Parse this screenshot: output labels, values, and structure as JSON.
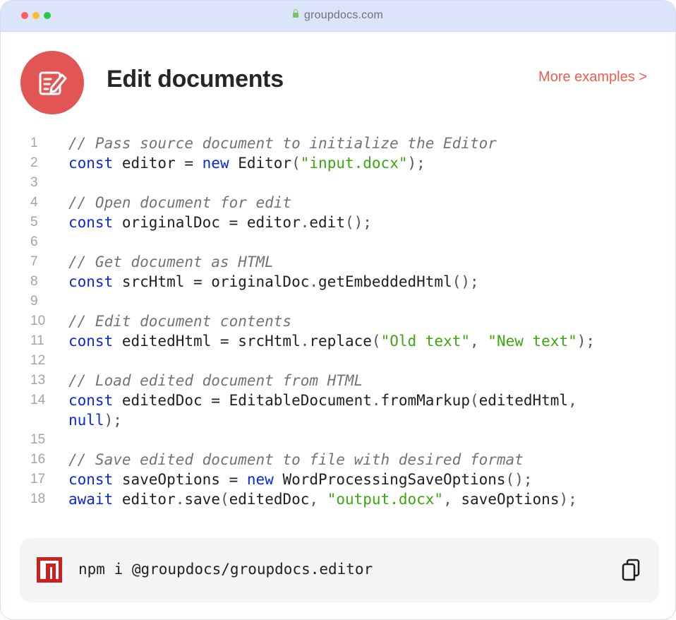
{
  "browser": {
    "url": "groupdocs.com"
  },
  "header": {
    "title": "Edit documents",
    "more_link": "More examples >"
  },
  "code": {
    "lines": [
      [
        {
          "t": "cm",
          "v": "// Pass source document to initialize the Editor"
        }
      ],
      [
        {
          "t": "kw",
          "v": "const"
        },
        {
          "t": "tx",
          "v": " editor = "
        },
        {
          "t": "kw",
          "v": "new"
        },
        {
          "t": "tx",
          "v": " Editor"
        },
        {
          "t": "pn",
          "v": "("
        },
        {
          "t": "st",
          "v": "\"input.docx\""
        },
        {
          "t": "pn",
          "v": ");"
        }
      ],
      [],
      [
        {
          "t": "cm",
          "v": "// Open document for edit"
        }
      ],
      [
        {
          "t": "kw",
          "v": "const"
        },
        {
          "t": "tx",
          "v": " originalDoc = editor"
        },
        {
          "t": "pn",
          "v": "."
        },
        {
          "t": "tx",
          "v": "edit"
        },
        {
          "t": "pn",
          "v": "();"
        }
      ],
      [],
      [
        {
          "t": "cm",
          "v": "// Get document as HTML"
        }
      ],
      [
        {
          "t": "kw",
          "v": "const"
        },
        {
          "t": "tx",
          "v": " srcHtml = originalDoc"
        },
        {
          "t": "pn",
          "v": "."
        },
        {
          "t": "tx",
          "v": "getEmbeddedHtml"
        },
        {
          "t": "pn",
          "v": "();"
        }
      ],
      [],
      [
        {
          "t": "cm",
          "v": "// Edit document contents"
        }
      ],
      [
        {
          "t": "kw",
          "v": "const"
        },
        {
          "t": "tx",
          "v": " editedHtml = srcHtml"
        },
        {
          "t": "pn",
          "v": "."
        },
        {
          "t": "tx",
          "v": "replace"
        },
        {
          "t": "pn",
          "v": "("
        },
        {
          "t": "st",
          "v": "\"Old text\""
        },
        {
          "t": "pn",
          "v": ", "
        },
        {
          "t": "st",
          "v": "\"New text\""
        },
        {
          "t": "pn",
          "v": ");"
        }
      ],
      [],
      [
        {
          "t": "cm",
          "v": "// Load edited document from HTML"
        }
      ],
      [
        {
          "t": "kw",
          "v": "const"
        },
        {
          "t": "tx",
          "v": " editedDoc = EditableDocument"
        },
        {
          "t": "pn",
          "v": "."
        },
        {
          "t": "tx",
          "v": "fromMarkup"
        },
        {
          "t": "pn",
          "v": "("
        },
        {
          "t": "tx",
          "v": "editedHtml"
        },
        {
          "t": "pn",
          "v": ","
        }
      ],
      [
        {
          "t": "kw",
          "v": "null"
        },
        {
          "t": "pn",
          "v": ");"
        }
      ],
      [],
      [
        {
          "t": "cm",
          "v": "// Save edited document to file with desired format"
        }
      ],
      [
        {
          "t": "kw",
          "v": "const"
        },
        {
          "t": "tx",
          "v": " saveOptions = "
        },
        {
          "t": "kw",
          "v": "new"
        },
        {
          "t": "tx",
          "v": " WordProcessingSaveOptions"
        },
        {
          "t": "pn",
          "v": "();"
        }
      ],
      [
        {
          "t": "kw",
          "v": "await"
        },
        {
          "t": "tx",
          "v": " editor"
        },
        {
          "t": "pn",
          "v": "."
        },
        {
          "t": "tx",
          "v": "save"
        },
        {
          "t": "pn",
          "v": "("
        },
        {
          "t": "tx",
          "v": "editedDoc"
        },
        {
          "t": "pn",
          "v": ", "
        },
        {
          "t": "st",
          "v": "\"output.docx\""
        },
        {
          "t": "pn",
          "v": ", "
        },
        {
          "t": "tx",
          "v": "saveOptions"
        },
        {
          "t": "pn",
          "v": ");"
        }
      ]
    ],
    "line_numbers": [
      "1",
      "2",
      "3",
      "4",
      "5",
      "6",
      "7",
      "8",
      "9",
      "10",
      "11",
      "12",
      "13",
      "14",
      "",
      "15",
      "16",
      "17",
      "18"
    ]
  },
  "install": {
    "command": "npm i @groupdocs/groupdocs.editor",
    "logo_icon": "npm-icon",
    "copy_icon": "copy-icon"
  },
  "colors": {
    "accent": "#e25555",
    "link": "#ee5b4f",
    "keyword": "#0a27e0",
    "string": "#3ba60f",
    "comment": "#737373"
  }
}
